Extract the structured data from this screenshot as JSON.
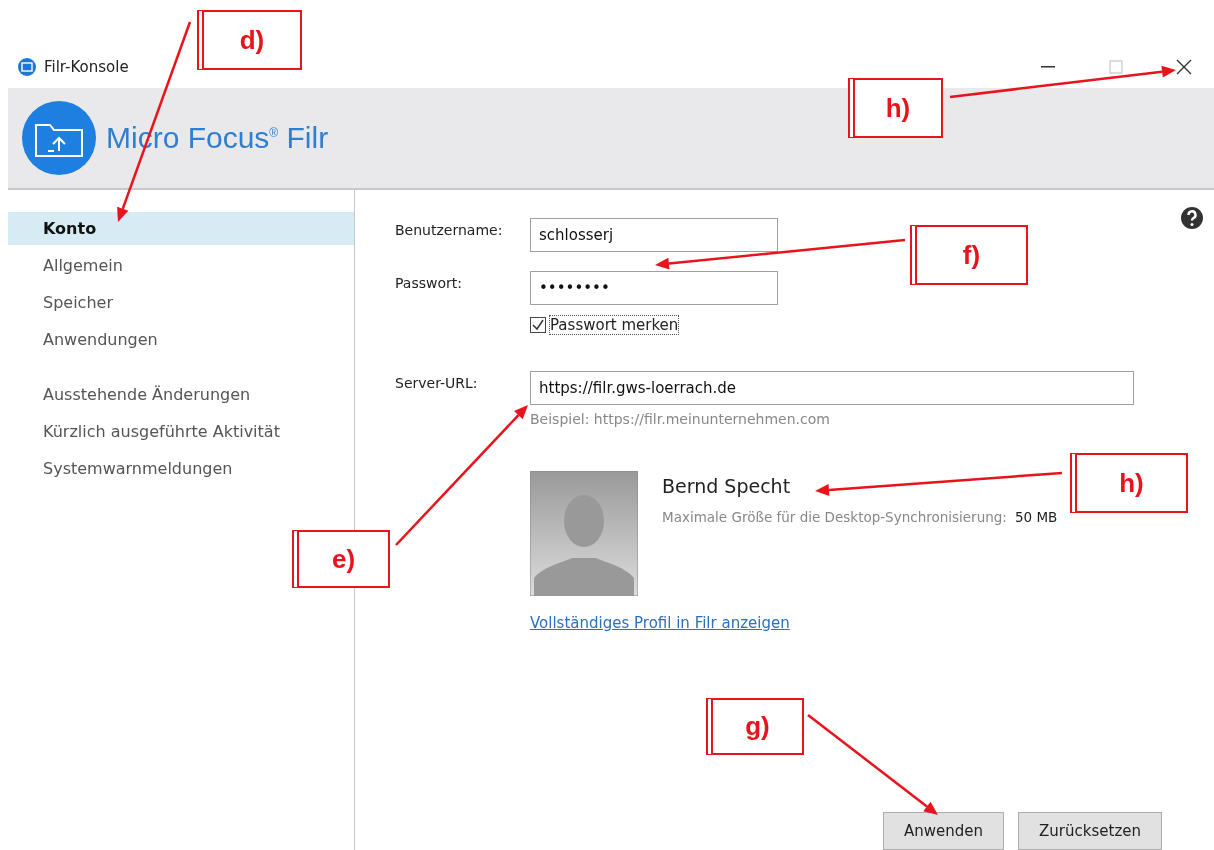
{
  "window": {
    "title": "Filr-Konsole"
  },
  "header": {
    "brand": "Micro Focus",
    "brand_mark": "®",
    "product": "Filr"
  },
  "sidebar": {
    "groups": [
      {
        "items": [
          {
            "label": "Konto",
            "selected": true
          },
          {
            "label": "Allgemein",
            "selected": false
          },
          {
            "label": "Speicher",
            "selected": false
          },
          {
            "label": "Anwendungen",
            "selected": false
          }
        ]
      },
      {
        "items": [
          {
            "label": "Ausstehende Änderungen",
            "selected": false
          },
          {
            "label": "Kürzlich ausgeführte Aktivität",
            "selected": false
          },
          {
            "label": "Systemwarnmeldungen",
            "selected": false
          }
        ]
      }
    ]
  },
  "form": {
    "username": {
      "label": "Benutzername:",
      "value": "schlosserj"
    },
    "password": {
      "label": "Passwort:",
      "value": "••••••••"
    },
    "remember": {
      "label": "Passwort merken",
      "checked": true
    },
    "server": {
      "label": "Server-URL:",
      "value": "https://filr.gws-loerrach.de",
      "hint": "Beispiel: https://filr.meinunternehmen.com"
    }
  },
  "profile": {
    "name": "Bernd Specht",
    "quota_label": "Maximale Größe für die Desktop-Synchronisierung:",
    "quota_value": "50 MB",
    "link": "Vollständiges Profil in Filr anzeigen"
  },
  "buttons": [
    "Anwenden",
    "Zurücksetzen"
  ],
  "callouts": [
    {
      "label": "d)"
    },
    {
      "label": "h)"
    },
    {
      "label": "f)"
    },
    {
      "label": "h)"
    },
    {
      "label": "e)"
    },
    {
      "label": "g)"
    }
  ]
}
